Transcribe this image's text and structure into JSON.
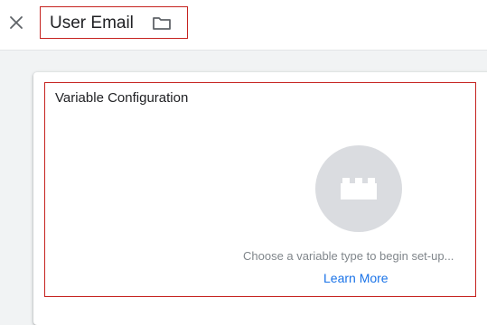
{
  "header": {
    "title": "User Email",
    "close_icon": "close-icon",
    "folder_icon": "folder-icon"
  },
  "config": {
    "title": "Variable Configuration",
    "type_icon": "lego-block-icon",
    "hint": "Choose a variable type to begin set-up...",
    "learn_more": "Learn More"
  },
  "colors": {
    "accent": "#1a73e8",
    "highlight_border": "#c5221f",
    "placeholder_circle": "#dadce0",
    "hint_text": "#80868b"
  }
}
